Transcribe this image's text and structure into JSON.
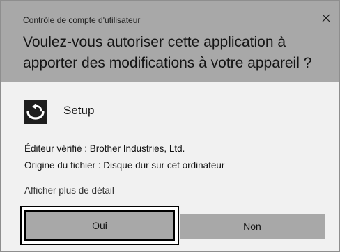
{
  "window": {
    "title": "Contrôle de compte d'utilisateur",
    "close_icon": "close-icon"
  },
  "prompt": {
    "question": "Voulez-vous autoriser cette application à apporter des modifications à votre appareil ?"
  },
  "app": {
    "icon": "setup-icon",
    "name": "Setup"
  },
  "details": {
    "publisher": "Éditeur vérifié : Brother Industries, Ltd.",
    "origin": "Origine du fichier : Disque dur sur cet ordinateur",
    "more_link": "Afficher plus de détail"
  },
  "buttons": {
    "yes": "Oui",
    "no": "Non"
  },
  "colors": {
    "header_bg": "#a8a8a8",
    "body_bg": "#f1f1f1",
    "button_bg": "#a8a8a8",
    "icon_bg": "#1e1e1e"
  }
}
